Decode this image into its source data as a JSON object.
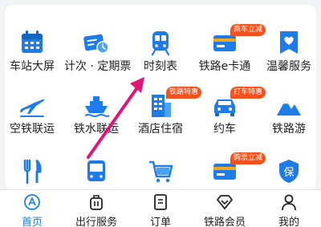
{
  "colors": {
    "accent": "#1e7ce8",
    "badge": "#f4511e",
    "arrow": "#e0157a"
  },
  "services": [
    {
      "label": "车站大屏",
      "icon": "calendar-icon"
    },
    {
      "label": "计次 · 定期票",
      "icon": "ticket-clock-icon"
    },
    {
      "label": "时刻表",
      "icon": "train-icon"
    },
    {
      "label": "铁路e卡通",
      "icon": "ecard-icon",
      "badge": "乘车立减"
    },
    {
      "label": "温馨服务",
      "icon": "heart-flag-icon"
    },
    {
      "label": "空铁联运",
      "icon": "airplane-icon"
    },
    {
      "label": "铁水联运",
      "icon": "ship-icon"
    },
    {
      "label": "酒店住宿",
      "icon": "hotel-icon",
      "badge": "铁路特惠"
    },
    {
      "label": "约车",
      "icon": "car-icon",
      "badge": "打车特惠"
    },
    {
      "label": "铁路游",
      "icon": "mountain-icon"
    },
    {
      "label": "",
      "icon": "fork-knife-icon"
    },
    {
      "label": "",
      "icon": "bus-icon"
    },
    {
      "label": "",
      "icon": "cart-icon"
    },
    {
      "label": "",
      "icon": "card-icon",
      "badge": "购票立减"
    },
    {
      "label": "",
      "icon": "shield-icon"
    }
  ],
  "tabs": [
    {
      "label": "首页",
      "icon": "home-icon",
      "active": true
    },
    {
      "label": "出行服务",
      "icon": "luggage-icon"
    },
    {
      "label": "订单",
      "icon": "order-icon"
    },
    {
      "label": "铁路会员",
      "icon": "diamond-icon"
    },
    {
      "label": "我的",
      "icon": "person-icon"
    }
  ]
}
